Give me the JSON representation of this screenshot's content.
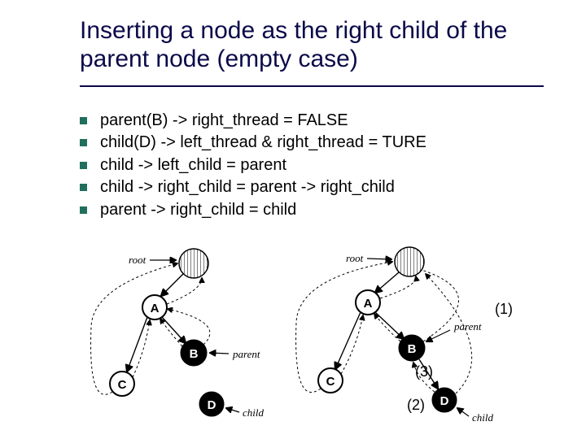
{
  "slide": {
    "title": "Inserting a node as the right child of the parent node (empty case)"
  },
  "bullets": [
    {
      "text": "parent(B) -> right_thread = FALSE"
    },
    {
      "text": "child(D) -> left_thread & right_thread = TURE"
    },
    {
      "text": "child -> left_child = parent"
    },
    {
      "text": "child -> right_child = parent -> right_child"
    },
    {
      "text": "parent -> right_child = child"
    }
  ],
  "diagram": {
    "root_label": "root",
    "parent_label": "parent",
    "child_label": "child",
    "nodes": [
      "A",
      "B",
      "C",
      "D"
    ],
    "annotations": {
      "step1": "(1)",
      "step2": "(2)",
      "step3": "(3)"
    }
  }
}
